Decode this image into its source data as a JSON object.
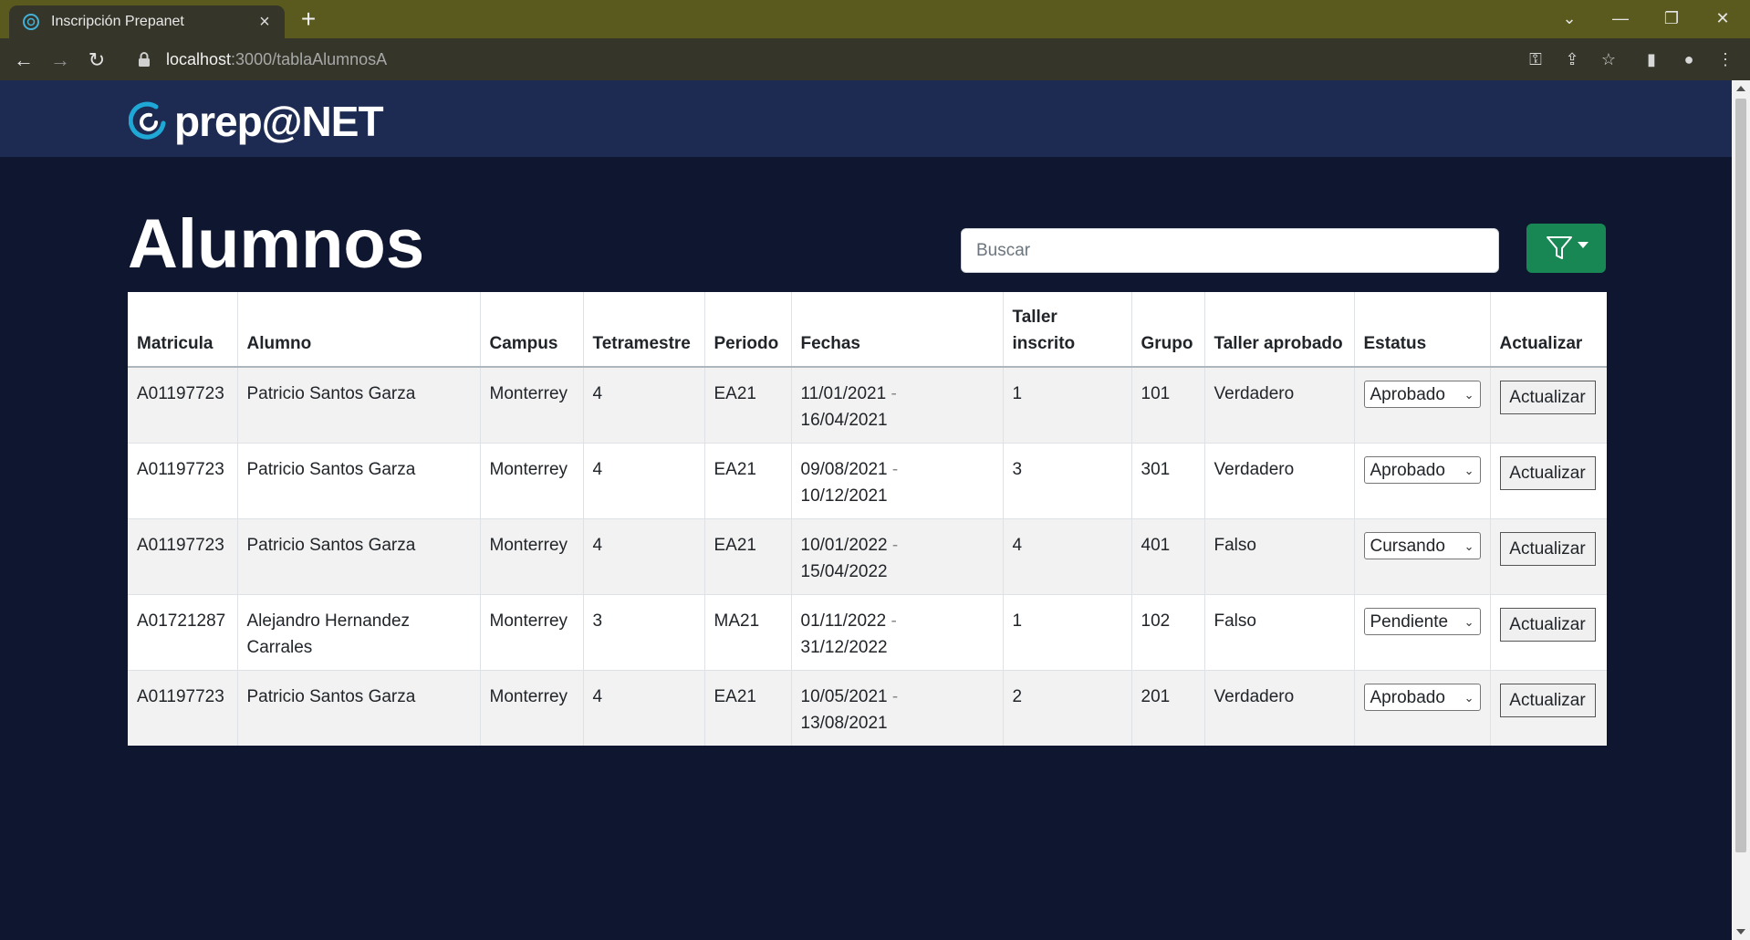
{
  "browser": {
    "tab_title": "Inscripción Prepanet",
    "url_host": "localhost",
    "url_path": ":3000/tablaAlumnosA"
  },
  "app": {
    "logo_text": "prep@NET",
    "page_title": "Alumnos",
    "search_placeholder": "Buscar",
    "accent_color": "#198754"
  },
  "table": {
    "headers": [
      "Matricula",
      "Alumno",
      "Campus",
      "Tetramestre",
      "Periodo",
      "Fechas",
      "Taller inscrito",
      "Grupo",
      "Taller aprobado",
      "Estatus",
      "Actualizar"
    ],
    "rows": [
      {
        "matricula": "A01197723",
        "alumno": "Patricio Santos Garza",
        "campus": "Monterrey",
        "tetramestre": "4",
        "periodo": "EA21",
        "fecha_inicio": "11/01/2021",
        "fecha_sep": "-",
        "fecha_fin": "16/04/2021",
        "taller": "1",
        "grupo": "101",
        "aprobado": "Verdadero",
        "estatus": "Aprobado",
        "boton": "Actualizar"
      },
      {
        "matricula": "A01197723",
        "alumno": "Patricio Santos Garza",
        "campus": "Monterrey",
        "tetramestre": "4",
        "periodo": "EA21",
        "fecha_inicio": "09/08/2021",
        "fecha_sep": "-",
        "fecha_fin": "10/12/2021",
        "taller": "3",
        "grupo": "301",
        "aprobado": "Verdadero",
        "estatus": "Aprobado",
        "boton": "Actualizar"
      },
      {
        "matricula": "A01197723",
        "alumno": "Patricio Santos Garza",
        "campus": "Monterrey",
        "tetramestre": "4",
        "periodo": "EA21",
        "fecha_inicio": "10/01/2022",
        "fecha_sep": "-",
        "fecha_fin": "15/04/2022",
        "taller": "4",
        "grupo": "401",
        "aprobado": "Falso",
        "estatus": "Cursando",
        "boton": "Actualizar"
      },
      {
        "matricula": "A01721287",
        "alumno": "Alejandro Hernandez Carrales",
        "campus": "Monterrey",
        "tetramestre": "3",
        "periodo": "MA21",
        "fecha_inicio": "01/11/2022",
        "fecha_sep": "-",
        "fecha_fin": "31/12/2022",
        "taller": "1",
        "grupo": "102",
        "aprobado": "Falso",
        "estatus": "Pendiente",
        "boton": "Actualizar"
      },
      {
        "matricula": "A01197723",
        "alumno": "Patricio Santos Garza",
        "campus": "Monterrey",
        "tetramestre": "4",
        "periodo": "EA21",
        "fecha_inicio": "10/05/2021",
        "fecha_sep": "-",
        "fecha_fin": "13/08/2021",
        "taller": "2",
        "grupo": "201",
        "aprobado": "Verdadero",
        "estatus": "Aprobado",
        "boton": "Actualizar"
      }
    ]
  }
}
